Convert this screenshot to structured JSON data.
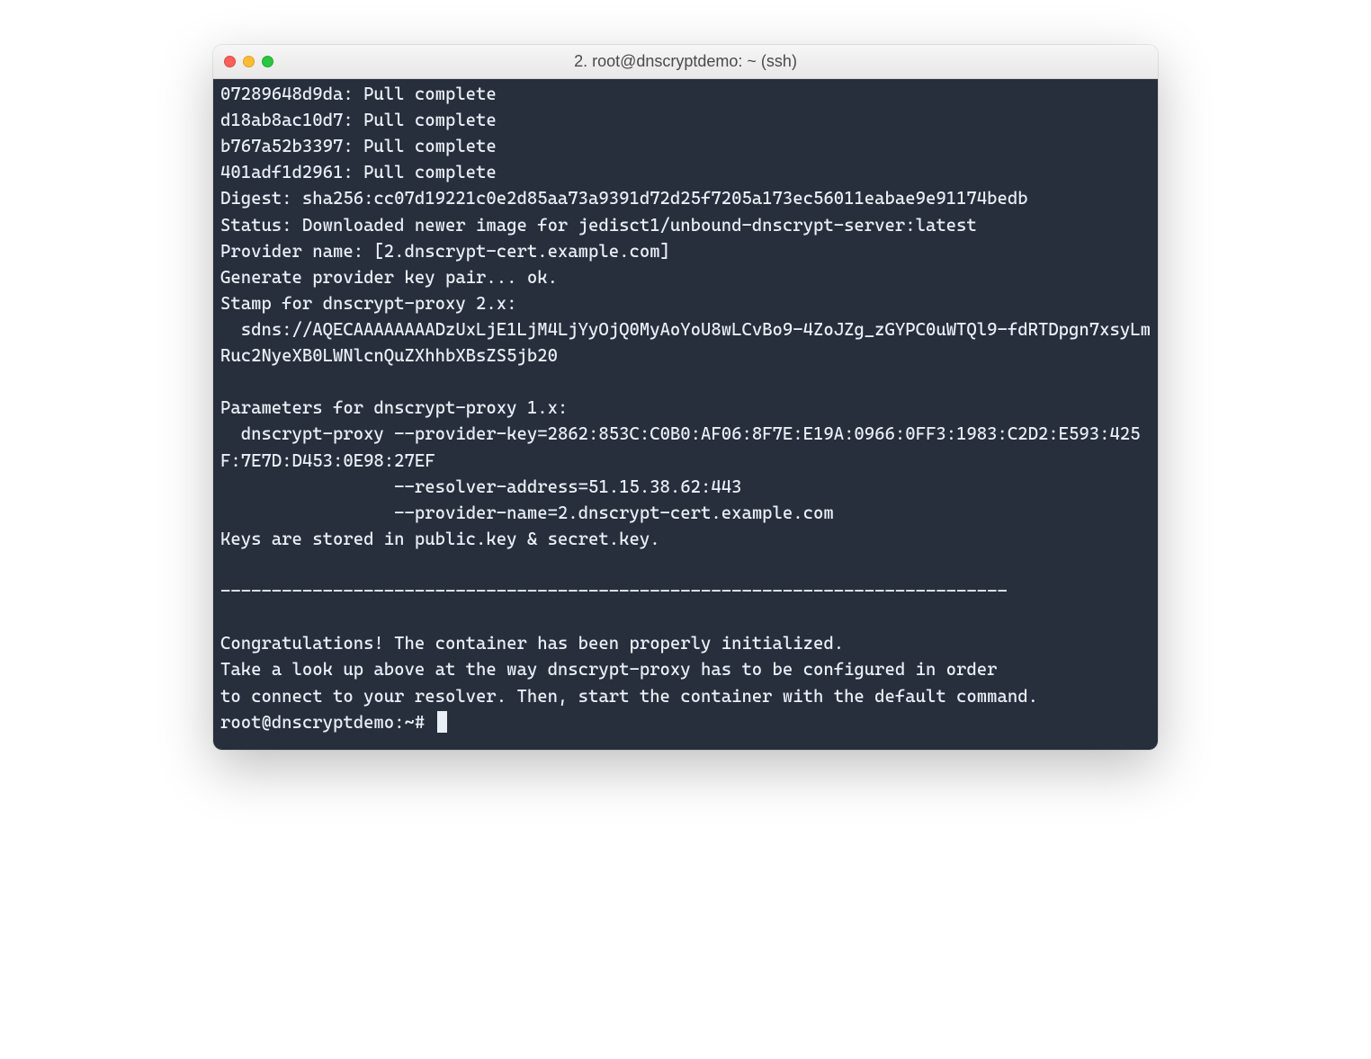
{
  "window": {
    "title": "2. root@dnscryptdemo: ~ (ssh)"
  },
  "terminal": {
    "output": "07289648d9da: Pull complete\nd18ab8ac10d7: Pull complete\nb767a52b3397: Pull complete\n401adf1d2961: Pull complete\nDigest: sha256:cc07d19221c0e2d85aa73a9391d72d25f7205a173ec56011eabae9e91174bedb\nStatus: Downloaded newer image for jedisct1/unbound-dnscrypt-server:latest\nProvider name: [2.dnscrypt-cert.example.com]\nGenerate provider key pair... ok.\nStamp for dnscrypt-proxy 2.x:\n  sdns://AQECAAAAAAAADzUxLjE1LjM4LjYyOjQ0MyAoYoU8wLCvBo9-4ZoJZg_zGYPC0uWTQl9-fdRTDpgn7xsyLmRuc2NyeXB0LWNlcnQuZXhhbXBsZS5jb20\n\nParameters for dnscrypt-proxy 1.x:\n  dnscrypt-proxy --provider-key=2862:853C:C0B0:AF06:8F7E:E19A:0966:0FF3:1983:C2D2:E593:425F:7E7D:D453:0E98:27EF\n                 --resolver-address=51.15.38.62:443\n                 --provider-name=2.dnscrypt-cert.example.com\nKeys are stored in public.key & secret.key.\n\n-----------------------------------------------------------------------------\n\nCongratulations! The container has been properly initialized.\nTake a look up above at the way dnscrypt-proxy has to be configured in order\nto connect to your resolver. Then, start the container with the default command.",
    "prompt": "root@dnscryptdemo:~# "
  }
}
